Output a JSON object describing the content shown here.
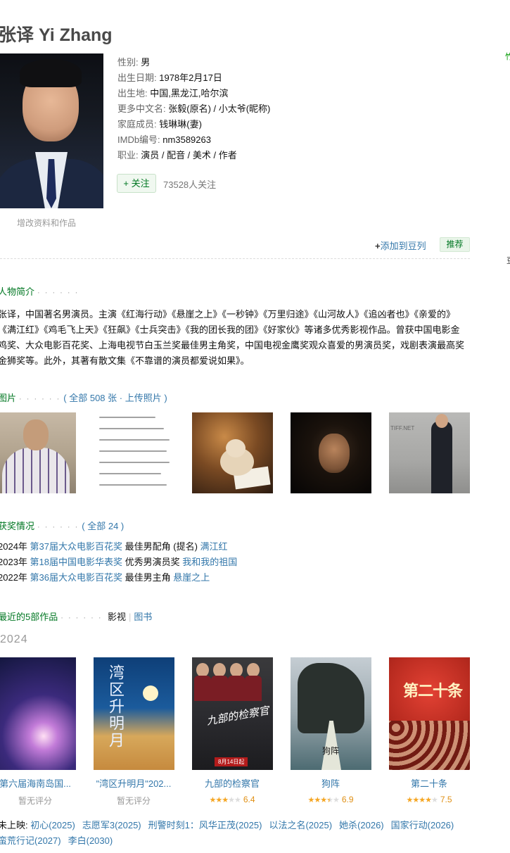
{
  "celebrity": {
    "name": "张译 Yi Zhang",
    "edit_link": "增改资料和作品",
    "info": [
      {
        "label": "性别: ",
        "value": "男"
      },
      {
        "label": "出生日期: ",
        "value": "1978年2月17日"
      },
      {
        "label": "出生地: ",
        "value": "中国,黑龙江,哈尔滨"
      },
      {
        "label": "更多中文名: ",
        "value": "张毅(原名) / 小太爷(昵称)"
      },
      {
        "label": "家庭成员: ",
        "value": "钱琳琳(妻)"
      },
      {
        "label": "IMDb编号: ",
        "value": "nm3589263"
      },
      {
        "label": "职业: ",
        "value": "演员 / 配音 / 美术 / 作者"
      }
    ],
    "follow_label": "+ 关注",
    "followers": "73528人关注",
    "add_doulist": "添加到豆列",
    "recommend": "推荐"
  },
  "bio": {
    "heading": "人物简介",
    "text": "张译，中国著名男演员。主演《红海行动》《悬崖之上》《一秒钟》《万里归途》《山河故人》《追凶者也》《亲爱的》《满江红》《鸡毛飞上天》《狂飙》《士兵突击》《我的团长我的团》《好家伙》等诸多优秀影视作品。曾获中国电影金鸡奖、大众电影百花奖、上海电视节白玉兰奖最佳男主角奖，中国电视金鹰奖观众喜爱的男演员奖，戏剧表演最高奖金狮奖等。此外，其著有散文集《不靠谱的演员都爱说如果》。"
  },
  "photos": {
    "heading": "图片",
    "all_label": "全部 508 张",
    "upload_label": "上传照片"
  },
  "awards": {
    "heading": "获奖情况",
    "all_label": "全部 24",
    "items": [
      {
        "year": "2024年 ",
        "festival": "第37届大众电影百花奖",
        "category": " 最佳男配角 (提名) ",
        "work": "满江红"
      },
      {
        "year": "2023年 ",
        "festival": "第18届中国电影华表奖",
        "category": " 优秀男演员奖 ",
        "work": "我和我的祖国"
      },
      {
        "year": "2022年 ",
        "festival": "第36届大众电影百花奖",
        "category": " 最佳男主角 ",
        "work": "悬崖之上"
      }
    ]
  },
  "works": {
    "heading": "最近的5部作品",
    "tab_film": "影视",
    "tab_book": "图书",
    "year": "2024",
    "items": [
      {
        "title": "第六届海南岛国...",
        "rating_text": "暂无评分"
      },
      {
        "title": "\"湾区升明月\"202...",
        "rating_text": "暂无评分"
      },
      {
        "title": "九部的检察官",
        "stars": 3,
        "score": "6.4"
      },
      {
        "title": "狗阵",
        "stars": 3.5,
        "score": "6.9"
      },
      {
        "title": "第二十条",
        "stars": 4,
        "score": "7.5"
      }
    ],
    "posters": {
      "p2_text": "湾区升明月",
      "p3_text": "九部的检察官",
      "p3_date": "8月14日起",
      "p4_text": "狗阵",
      "p5_text": "第二十条"
    },
    "upcoming_label": "未上映: ",
    "upcoming": [
      {
        "title": "初心",
        "year": "(2025)"
      },
      {
        "title": "志愿军3",
        "year": "(2025)"
      },
      {
        "title": "刑警时刻1：风华正茂",
        "year": "(2025)"
      },
      {
        "title": "以法之名",
        "year": "(2025)"
      },
      {
        "title": "她杀",
        "year": "(2026)"
      },
      {
        "title": "国家行动",
        "year": "(2026)"
      },
      {
        "title": "蛮荒行记",
        "year": "(2027)"
      },
      {
        "title": "李白",
        "year": "(2030)"
      }
    ]
  },
  "photo_texts": {
    "tiff": "TIFF.NET"
  },
  "colors": {
    "link": "#3377aa",
    "section_green": "#007722",
    "star": "#f5a623"
  }
}
